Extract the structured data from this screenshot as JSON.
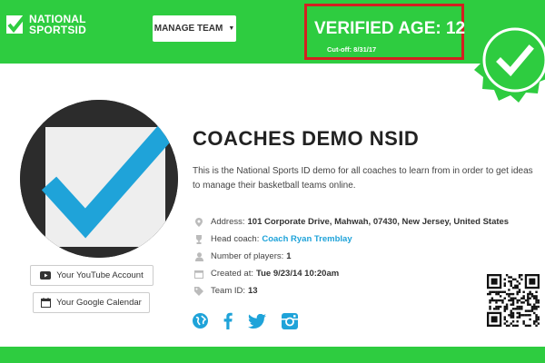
{
  "header": {
    "logo": {
      "line1": "NATIONAL",
      "line2": "SPORTSID"
    },
    "manage_label": "MANAGE TEAM",
    "verified": {
      "title": "VERIFIED AGE: 12",
      "cutoff": "Cut-off: 8/31/17"
    }
  },
  "profile": {
    "title": "COACHES DEMO NSID",
    "description": "This is the National Sports ID demo for all coaches to learn from in order to get ideas to manage their basketball teams online.",
    "address_label": "Address:",
    "address_value": "101 Corporate Drive, Mahwah, 07430, New Jersey, United States",
    "coach_label": "Head coach:",
    "coach_value": "Coach Ryan Tremblay",
    "players_label": "Number of players:",
    "players_value": "1",
    "created_label": "Created at:",
    "created_value": "Tue 9/23/14 10:20am",
    "teamid_label": "Team ID:",
    "teamid_value": "13"
  },
  "buttons": {
    "youtube": "Your YouTube Account",
    "calendar": "Your Google Calendar"
  },
  "social_icons": [
    "globe-icon",
    "facebook-icon",
    "twitter-icon",
    "instagram-icon"
  ],
  "colors": {
    "brand_green": "#2ecc40",
    "accent_blue": "#1fa3d9",
    "highlight_red": "#d42020"
  }
}
